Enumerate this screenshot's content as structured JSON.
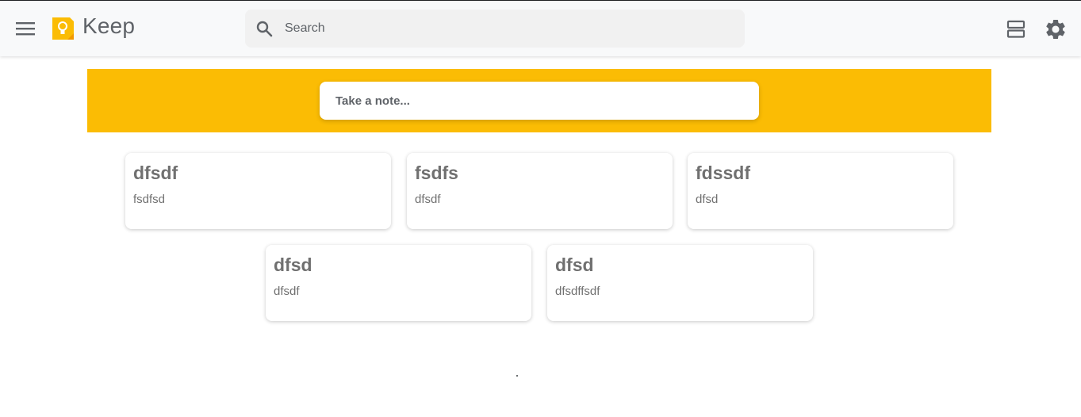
{
  "app": {
    "title": "Keep"
  },
  "header": {
    "menu_icon": "menu-icon",
    "search": {
      "placeholder": "Search",
      "value": "",
      "icon": "search-icon"
    },
    "list_view_icon": "list-view-icon",
    "settings_icon": "gear-icon"
  },
  "composer": {
    "placeholder": "Take a note...",
    "value": "",
    "banner_color": "#fbbc04"
  },
  "notes": [
    {
      "title": "dfsdf",
      "body": "fsdfsd"
    },
    {
      "title": "fsdfs",
      "body": "dfsdf"
    },
    {
      "title": "fdssdf",
      "body": "dfsd"
    },
    {
      "title": "dfsd",
      "body": "dfsdf"
    },
    {
      "title": "dfsd",
      "body": "dfsdffsdf"
    }
  ],
  "colors": {
    "accent": "#fbbc04",
    "text": "#5f6368",
    "note_text": "#707070"
  }
}
